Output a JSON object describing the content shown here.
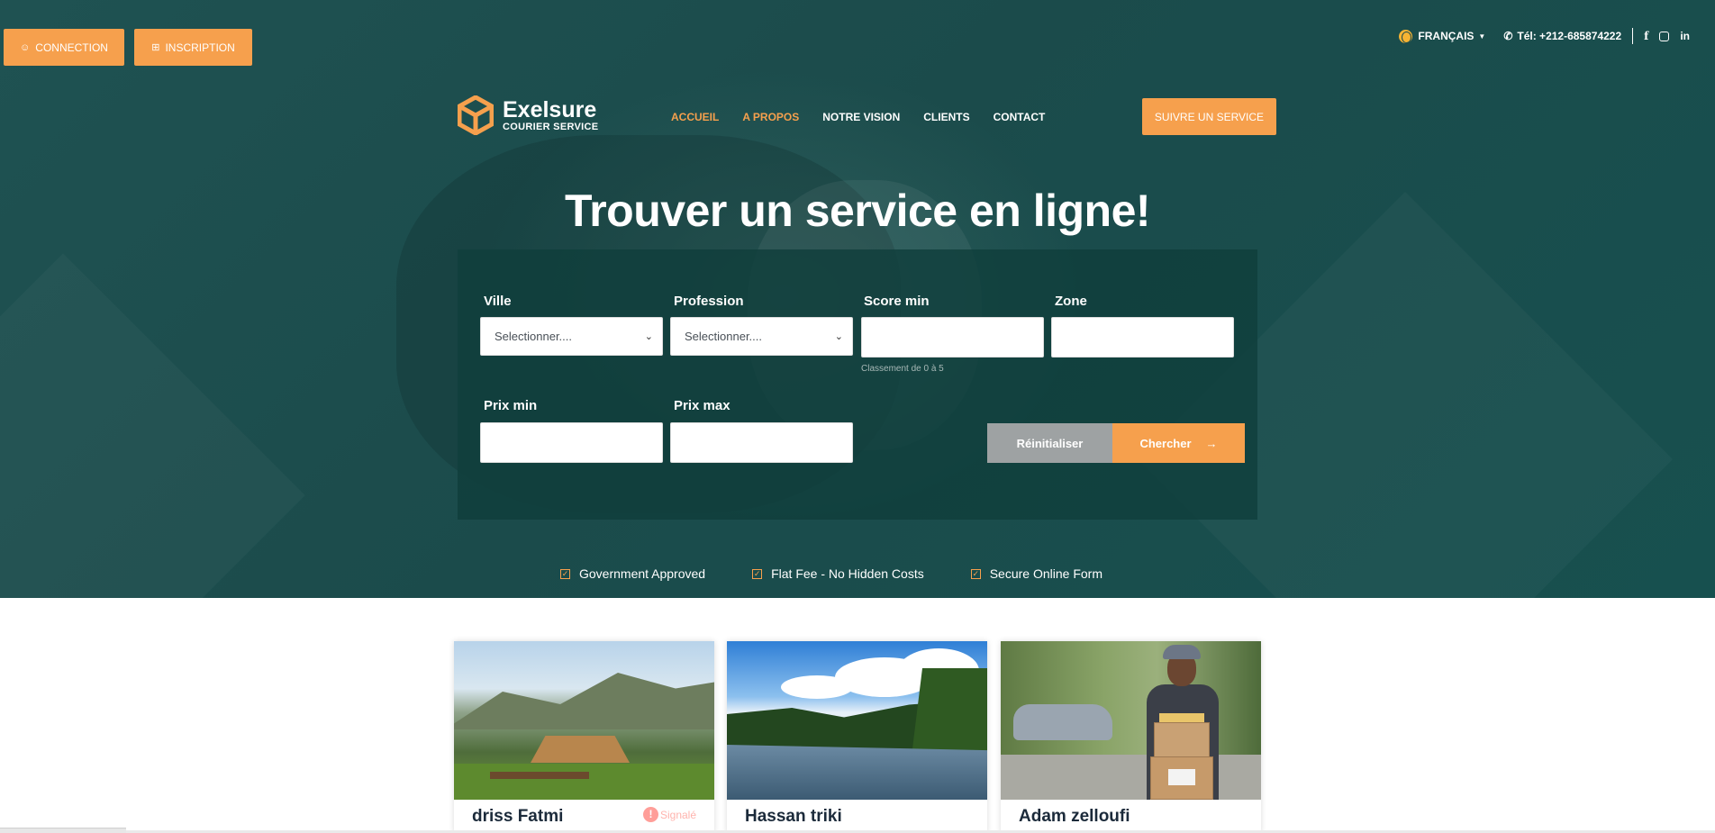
{
  "auth": {
    "login_label": "CONNECTION",
    "register_label": "INSCRIPTION"
  },
  "topbar": {
    "language": "FRANÇAIS",
    "phone": "Tél: +212-685874222"
  },
  "brand": {
    "name": "Exelsure",
    "tagline": "COURIER SERVICE",
    "accent": "#f6a04d"
  },
  "nav": {
    "items": [
      {
        "label": "ACCUEIL"
      },
      {
        "label": "A PROPOS"
      },
      {
        "label": "NOTRE VISION"
      },
      {
        "label": "CLIENTS"
      },
      {
        "label": "CONTACT"
      }
    ],
    "cta_label": "SUIVRE UN SERVICE"
  },
  "hero": {
    "title": "Trouver un service en ligne!"
  },
  "search": {
    "city": {
      "label": "Ville",
      "value": "Selectionner...."
    },
    "profession": {
      "label": "Profession",
      "value": "Selectionner...."
    },
    "score": {
      "label": "Score min",
      "hint": "Classement de 0 à 5"
    },
    "zone": {
      "label": "Zone"
    },
    "price_min": {
      "label": "Prix min"
    },
    "price_max": {
      "label": "Prix max"
    },
    "reset_label": "Réinitialiser",
    "search_label": "Chercher"
  },
  "features": [
    {
      "label": "Government Approved"
    },
    {
      "label": "Flat Fee - No Hidden Costs"
    },
    {
      "label": "Secure Online Form"
    }
  ],
  "cards": [
    {
      "name": "driss Fatmi",
      "flag": "Signalé"
    },
    {
      "name": "Hassan triki"
    },
    {
      "name": "Adam zelloufi"
    }
  ]
}
